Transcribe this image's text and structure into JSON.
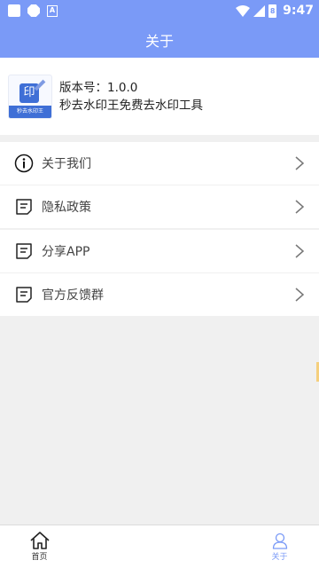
{
  "status_bar": {
    "time": "9:47",
    "battery": "8"
  },
  "header": {
    "title": "关于"
  },
  "app_info": {
    "logo_char": "印",
    "logo_caption": "秒去水印王",
    "version": "版本号：1.0.0",
    "name": "秒去水印王免费去水印工具"
  },
  "menu": [
    {
      "label": "关于我们",
      "icon": "info-icon"
    },
    {
      "label": "隐私政策",
      "icon": "document-icon"
    },
    {
      "label": "分享APP",
      "icon": "document-icon"
    },
    {
      "label": "官方反馈群",
      "icon": "document-icon"
    }
  ],
  "tabbar": {
    "home": "首页",
    "about": "关于",
    "active": "about"
  },
  "colors": {
    "accent": "#7a9af7",
    "logo_blue": "#3f6fd6"
  }
}
